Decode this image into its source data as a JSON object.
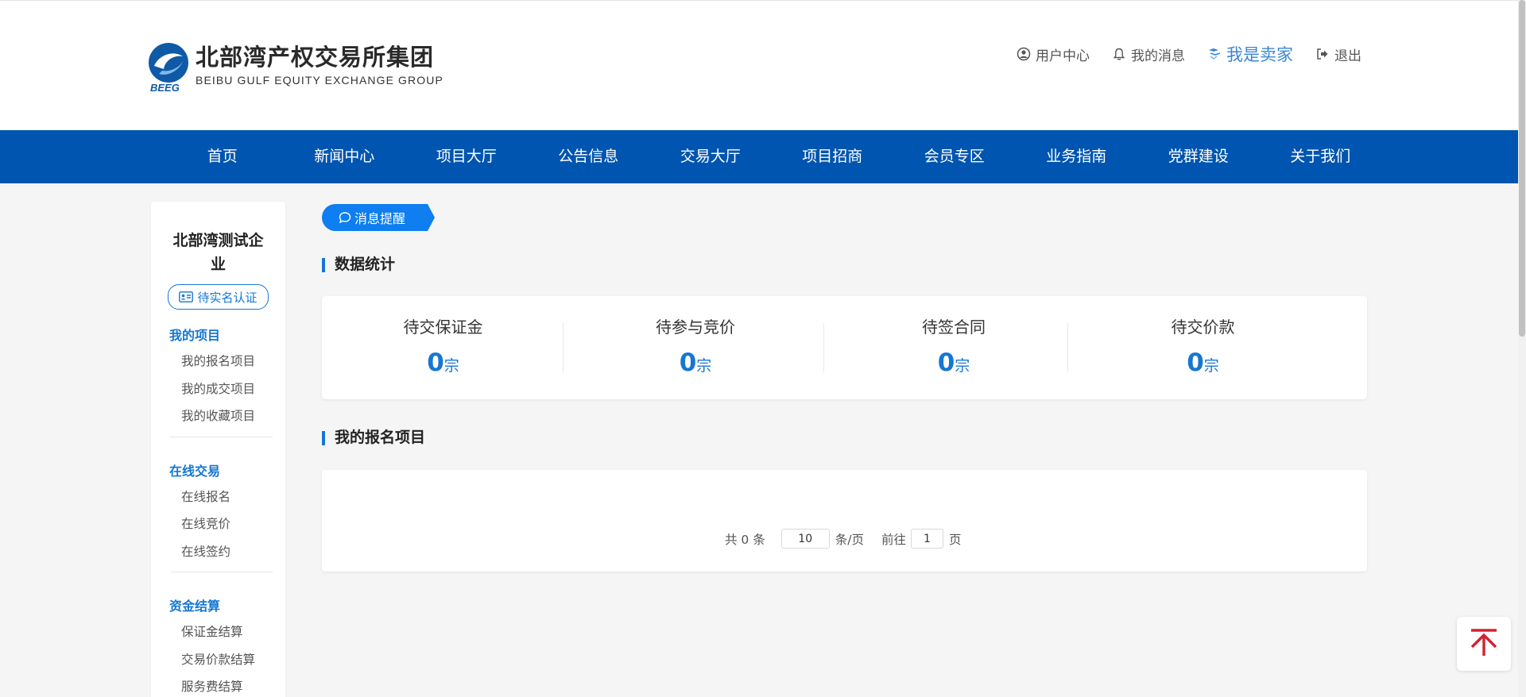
{
  "brand": {
    "logo_abbr": "BEEG",
    "name_cn": "北部湾产权交易所集团",
    "name_en": "BEIBU GULF EQUITY EXCHANGE GROUP",
    "accent": "#0055b0"
  },
  "top_links": {
    "user_center": "用户中心",
    "messages": "我的消息",
    "seller": "我是卖家",
    "logout": "退出"
  },
  "nav": {
    "items": [
      "首页",
      "新闻中心",
      "项目大厅",
      "公告信息",
      "交易大厅",
      "项目招商",
      "会员专区",
      "业务指南",
      "党群建设",
      "关于我们"
    ]
  },
  "sidebar": {
    "company_name": "北部湾测试企业",
    "verify_label": "待实名认证",
    "groups": [
      {
        "title": "我的项目",
        "items": [
          "我的报名项目",
          "我的成交项目",
          "我的收藏项目"
        ]
      },
      {
        "title": "在线交易",
        "items": [
          "在线报名",
          "在线竞价",
          "在线签约"
        ]
      },
      {
        "title": "资金结算",
        "items": [
          "保证金结算",
          "交易价款结算",
          "服务费结算"
        ]
      }
    ]
  },
  "notice_tag": "消息提醒",
  "stats": {
    "title": "数据统计",
    "items": [
      {
        "label": "待交保证金",
        "value": "0",
        "unit": "宗"
      },
      {
        "label": "待参与竞价",
        "value": "0",
        "unit": "宗"
      },
      {
        "label": "待签合同",
        "value": "0",
        "unit": "宗"
      },
      {
        "label": "待交价款",
        "value": "0",
        "unit": "宗"
      }
    ]
  },
  "registered": {
    "title": "我的报名项目",
    "pager": {
      "total_text": "共 0 条",
      "page_size": "10",
      "per_page_text": "条/页",
      "goto_text": "前往",
      "page": "1",
      "page_unit": "页"
    }
  }
}
